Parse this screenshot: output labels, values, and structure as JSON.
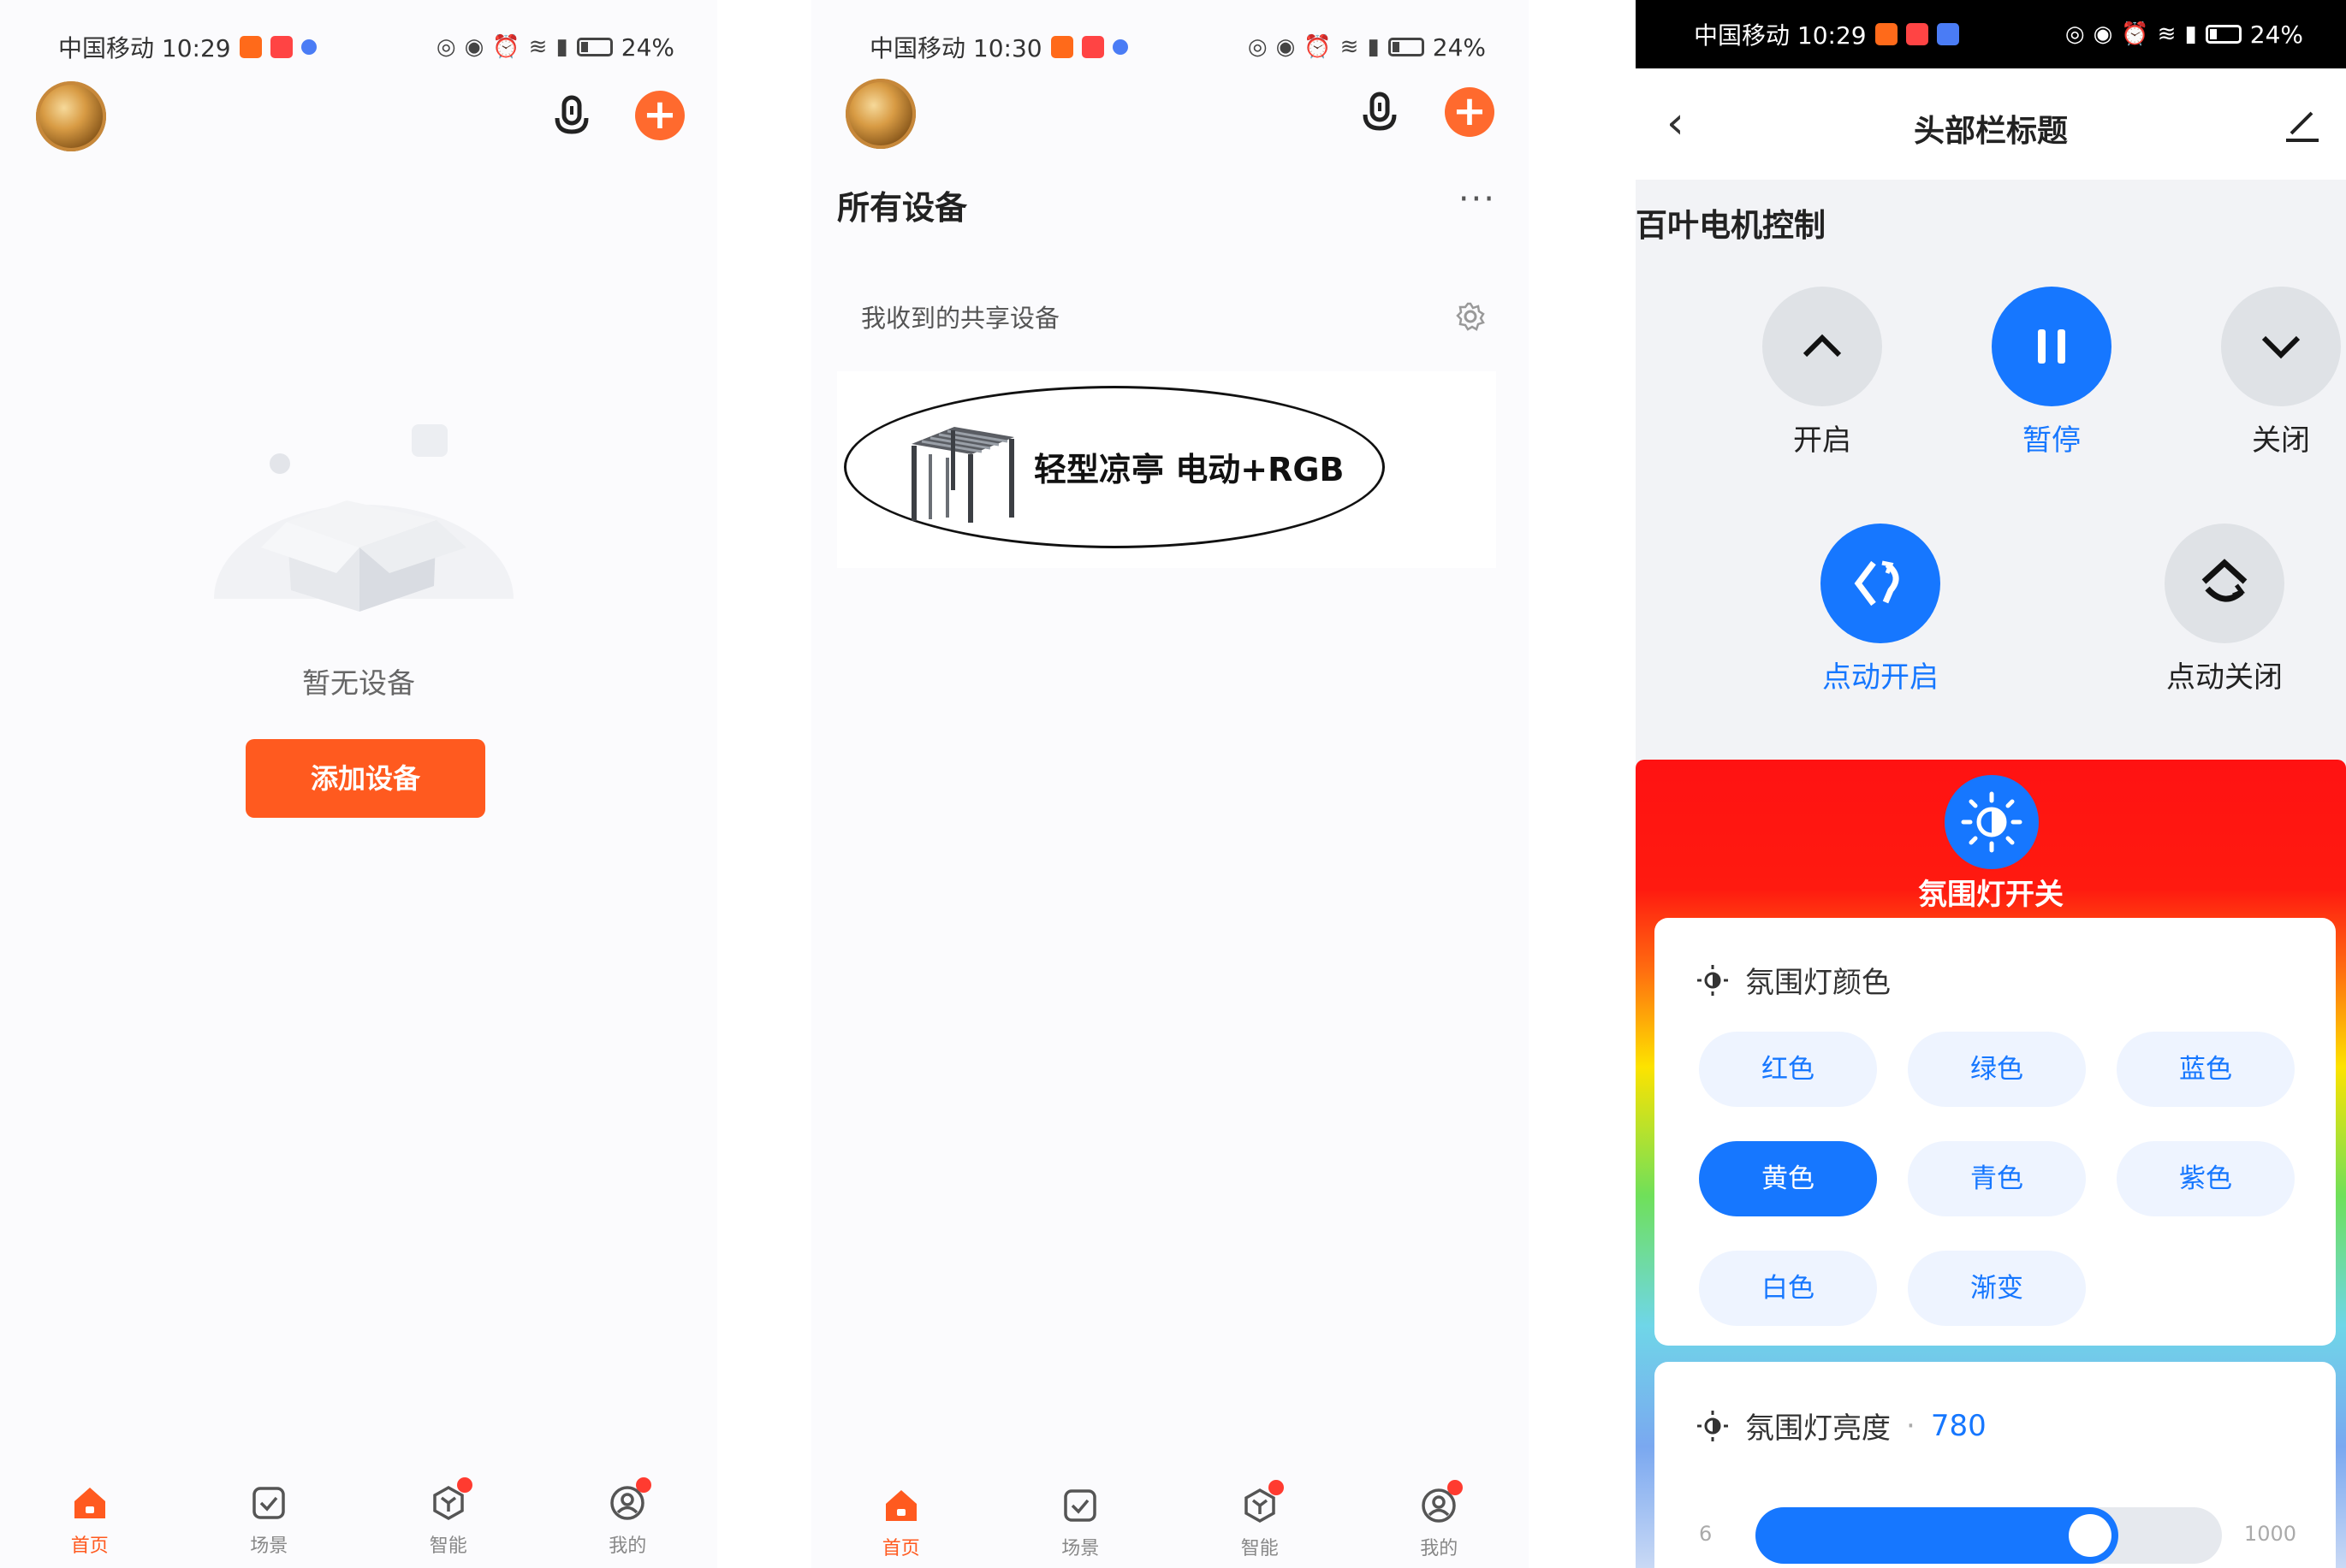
{
  "panel1": {
    "status": {
      "carrier_time": "中国移动 10:29",
      "battery": "24%"
    },
    "empty_text": "暂无设备",
    "add_button": "添加设备",
    "nav": [
      {
        "label": "首页",
        "icon": "home-icon",
        "active": true
      },
      {
        "label": "场景",
        "icon": "scene-check-icon",
        "active": false
      },
      {
        "label": "智能",
        "icon": "smart-cube-icon",
        "active": false,
        "badge": true
      },
      {
        "label": "我的",
        "icon": "profile-icon",
        "active": false,
        "badge": true
      }
    ]
  },
  "panel2": {
    "status": {
      "carrier_time": "中国移动 10:30",
      "battery": "24%"
    },
    "section_title": "所有设备",
    "more": "···",
    "shared_label": "我收到的共享设备",
    "device_name": "轻型凉亭 电动+RGB",
    "nav": [
      {
        "label": "首页",
        "icon": "home-icon",
        "active": true
      },
      {
        "label": "场景",
        "icon": "scene-check-icon",
        "active": false
      },
      {
        "label": "智能",
        "icon": "smart-cube-icon",
        "active": false,
        "badge": true
      },
      {
        "label": "我的",
        "icon": "profile-icon",
        "active": false,
        "badge": true
      }
    ]
  },
  "panel3": {
    "status": {
      "carrier_time": "中国移动 10:29",
      "battery": "24%"
    },
    "header_title": "头部栏标题",
    "motor_title": "百叶电机控制",
    "controls": {
      "open": "开启",
      "pause": "暂停",
      "close": "关闭",
      "jog_open": "点动开启",
      "jog_close": "点动关闭"
    },
    "ambient_title": "氛围灯开关",
    "color_title": "氛围灯颜色",
    "colors": [
      "红色",
      "绿色",
      "蓝色",
      "黄色",
      "青色",
      "紫色",
      "白色",
      "渐变"
    ],
    "selected_color": "黄色",
    "brightness_title": "氛围灯亮度",
    "brightness_sep": "·",
    "brightness_value": "780",
    "slider": {
      "min": "6",
      "max": "1000",
      "value": 780
    },
    "accent": "#1677ff"
  },
  "theme": {
    "brand_orange": "#ff5a1f",
    "blue": "#1677ff"
  }
}
